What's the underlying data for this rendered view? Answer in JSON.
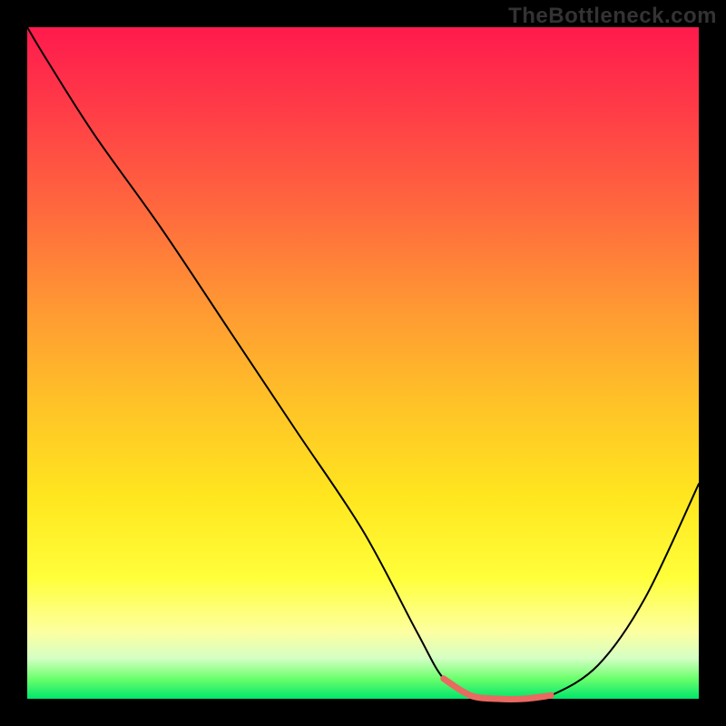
{
  "watermark": "TheBottleneck.com",
  "chart_data": {
    "type": "line",
    "title": "",
    "xlabel": "",
    "ylabel": "",
    "xlim": [
      0,
      100
    ],
    "ylim": [
      0,
      100
    ],
    "gradient_stops": [
      {
        "pct": 0,
        "color": "#ff1a4d"
      },
      {
        "pct": 12,
        "color": "#ff3b47"
      },
      {
        "pct": 28,
        "color": "#ff6b3d"
      },
      {
        "pct": 42,
        "color": "#ff9933"
      },
      {
        "pct": 56,
        "color": "#ffc227"
      },
      {
        "pct": 70,
        "color": "#ffe61f"
      },
      {
        "pct": 82,
        "color": "#ffff3a"
      },
      {
        "pct": 90,
        "color": "#fdffa0"
      },
      {
        "pct": 94,
        "color": "#d4ffc4"
      },
      {
        "pct": 97,
        "color": "#6cff6c"
      },
      {
        "pct": 100,
        "color": "#00e66b"
      }
    ],
    "series": [
      {
        "name": "bottleneck-curve",
        "color": "#000000",
        "width": 2,
        "x": [
          0,
          3,
          10,
          20,
          30,
          40,
          50,
          58,
          62,
          66,
          70,
          74,
          78,
          85,
          92,
          100
        ],
        "y": [
          100,
          95,
          84,
          70,
          55,
          40,
          25,
          10,
          3,
          0.5,
          0,
          0,
          0.5,
          5,
          15,
          32
        ]
      },
      {
        "name": "highlight-segment",
        "color": "#e86a61",
        "width": 7,
        "x": [
          62,
          66,
          70,
          74,
          78
        ],
        "y": [
          3,
          0.5,
          0,
          0,
          0.5
        ]
      }
    ]
  }
}
